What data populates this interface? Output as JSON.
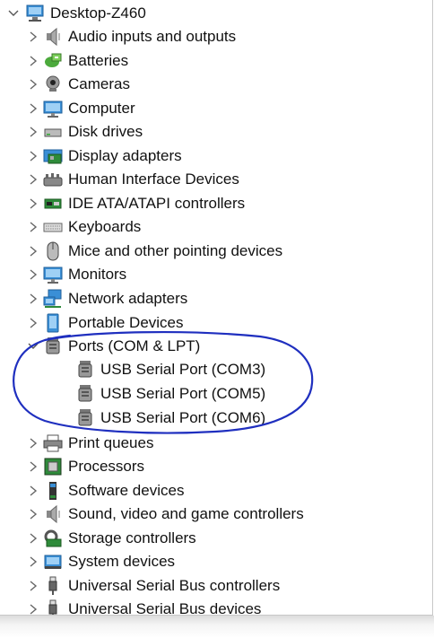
{
  "tree": {
    "root": {
      "label": "Desktop-Z460",
      "icon": "computer-icon",
      "expanded": true
    },
    "categories": [
      {
        "label": "Audio inputs and outputs",
        "icon": "speaker-icon",
        "expanded": false
      },
      {
        "label": "Batteries",
        "icon": "battery-icon",
        "expanded": false
      },
      {
        "label": "Cameras",
        "icon": "camera-icon",
        "expanded": false
      },
      {
        "label": "Computer",
        "icon": "monitor-icon",
        "expanded": false
      },
      {
        "label": "Disk drives",
        "icon": "disk-drive-icon",
        "expanded": false
      },
      {
        "label": "Display adapters",
        "icon": "display-adapter-icon",
        "expanded": false
      },
      {
        "label": "Human Interface Devices",
        "icon": "hid-icon",
        "expanded": false
      },
      {
        "label": "IDE ATA/ATAPI controllers",
        "icon": "ide-controller-icon",
        "expanded": false
      },
      {
        "label": "Keyboards",
        "icon": "keyboard-icon",
        "expanded": false
      },
      {
        "label": "Mice and other pointing devices",
        "icon": "mouse-icon",
        "expanded": false
      },
      {
        "label": "Monitors",
        "icon": "monitor-icon",
        "expanded": false
      },
      {
        "label": "Network adapters",
        "icon": "network-icon",
        "expanded": false
      },
      {
        "label": "Portable Devices",
        "icon": "portable-device-icon",
        "expanded": false
      },
      {
        "label": "Ports (COM & LPT)",
        "icon": "port-icon",
        "expanded": true,
        "children": [
          {
            "label": "USB Serial Port (COM3)",
            "icon": "port-icon"
          },
          {
            "label": "USB Serial Port (COM5)",
            "icon": "port-icon"
          },
          {
            "label": "USB Serial Port (COM6)",
            "icon": "port-icon"
          }
        ]
      },
      {
        "label": "Print queues",
        "icon": "printer-icon",
        "expanded": false
      },
      {
        "label": "Processors",
        "icon": "processor-icon",
        "expanded": false
      },
      {
        "label": "Software devices",
        "icon": "software-device-icon",
        "expanded": false
      },
      {
        "label": "Sound, video and game controllers",
        "icon": "speaker-icon",
        "expanded": false
      },
      {
        "label": "Storage controllers",
        "icon": "storage-controller-icon",
        "expanded": false
      },
      {
        "label": "System devices",
        "icon": "system-device-icon",
        "expanded": false
      },
      {
        "label": "Universal Serial Bus controllers",
        "icon": "usb-icon",
        "expanded": false
      },
      {
        "label": "Universal Serial Bus devices",
        "icon": "usb-icon",
        "expanded": false
      }
    ]
  },
  "colors": {
    "annotation": "#1f2fbf",
    "chevron": "#6a6a6a",
    "text": "#111111"
  }
}
